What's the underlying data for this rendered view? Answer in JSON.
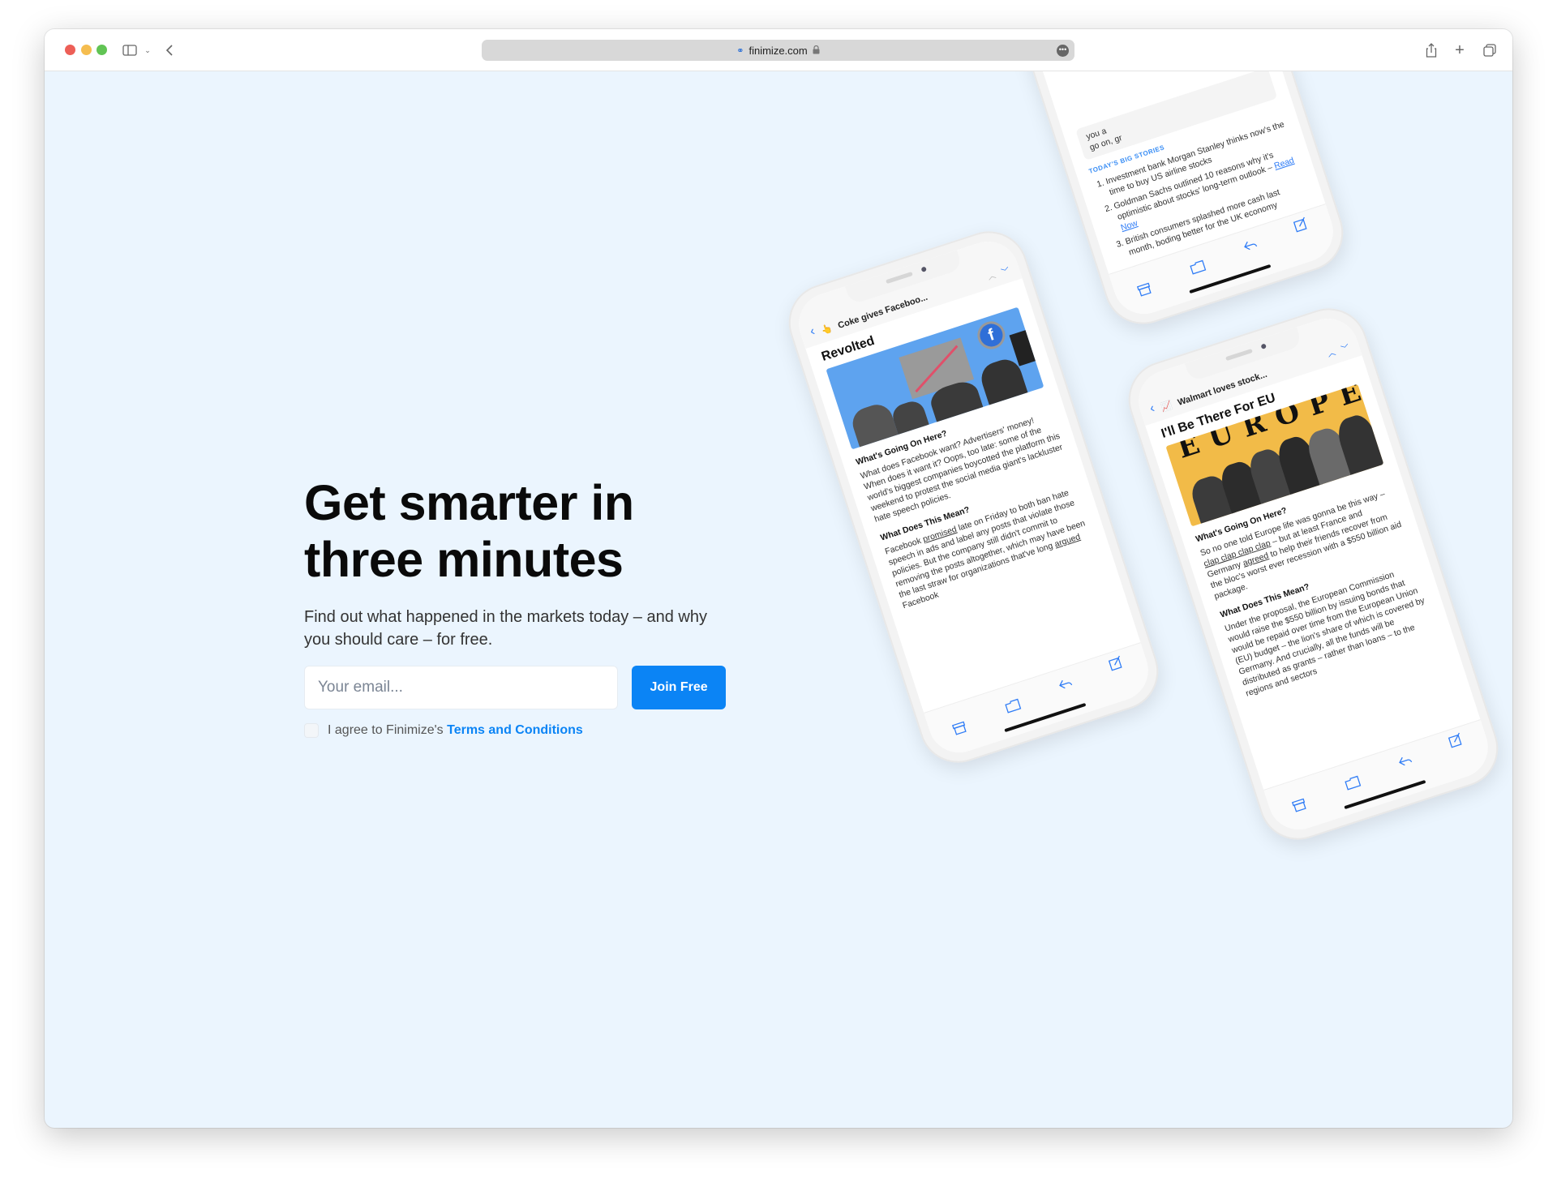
{
  "browser": {
    "url": "finimize.com",
    "traffic_lights": [
      "#ed5f57",
      "#f5bd4f",
      "#61c454"
    ],
    "icons": [
      "sidebar-icon",
      "chevron-down-icon",
      "back-icon",
      "lock-icon",
      "more-icon",
      "share-icon",
      "new-tab-icon",
      "tabs-icon"
    ]
  },
  "hero": {
    "title_line1": "Get smarter in",
    "title_line2": "three minutes",
    "subtitle": "Find out what happened in the markets today – and why you should care – for free.",
    "email_placeholder": "Your email...",
    "join_label": "Join Free",
    "agree_text": "I agree to Finimize's ",
    "terms_link": "Terms and Conditions"
  },
  "colors": {
    "accent": "#0b84f5",
    "background": "#ebf5fe"
  },
  "phones": [
    {
      "emoji": "👆",
      "subject": "Coke gives Faceboo...",
      "title": "Revolted",
      "h1": "What's Going On Here?",
      "p1": "What does Facebook want? Advertisers' money! When does it want it? Oops, too late: some of the world's biggest companies boycotted the platform this weekend to protest the social media giant's lackluster hate speech policies.",
      "h2": "What Does This Mean?",
      "p2a": "Facebook ",
      "p2b": "promised",
      "p2c": " late on Friday to both ban hate speech in ads and label any posts that violate those policies. But the company still didn't commit to removing the posts altogether, which may have been the last straw for organizations that've long ",
      "p2d": "argued",
      "p2e": " Facebook"
    },
    {
      "emoji": "📈",
      "subject": "Walmart loves stock...",
      "title": "I'll Be There For EU",
      "image_text": "EUROPE",
      "h1": "What's Going On Here?",
      "p1a": "So no one told Europe life was gonna be this way – ",
      "p1b": "clap clap clap clap",
      "p1c": " – but at least France and Germany ",
      "p1d": "agreed",
      "p1e": " to help their friends recover from the bloc's worst ever recession with a $550 billion aid package.",
      "h2": "What Does This Mean?",
      "p2": "Under the proposal, the European Commission would raise the $550 billion by issuing bonds that would be repaid over time from the European Union (EU) budget – the lion's share of which is covered by Germany. And crucially, all the funds will be distributed as grants – rather than loans – to the regions and sectors"
    },
    {
      "partial1": "you a",
      "partial2": "go on, gr",
      "stories_label": "TODAY'S BIG STORIES",
      "story1": "Investment bank Morgan Stanley thinks now's the time to buy US airline stocks",
      "story2": "Goldman Sachs outlined 10 reasons why it's optimistic about stocks' long-term outlook – ",
      "story2_link": "Read Now",
      "story3": "British consumers splashed more cash last month, boding better for the UK economy"
    }
  ]
}
